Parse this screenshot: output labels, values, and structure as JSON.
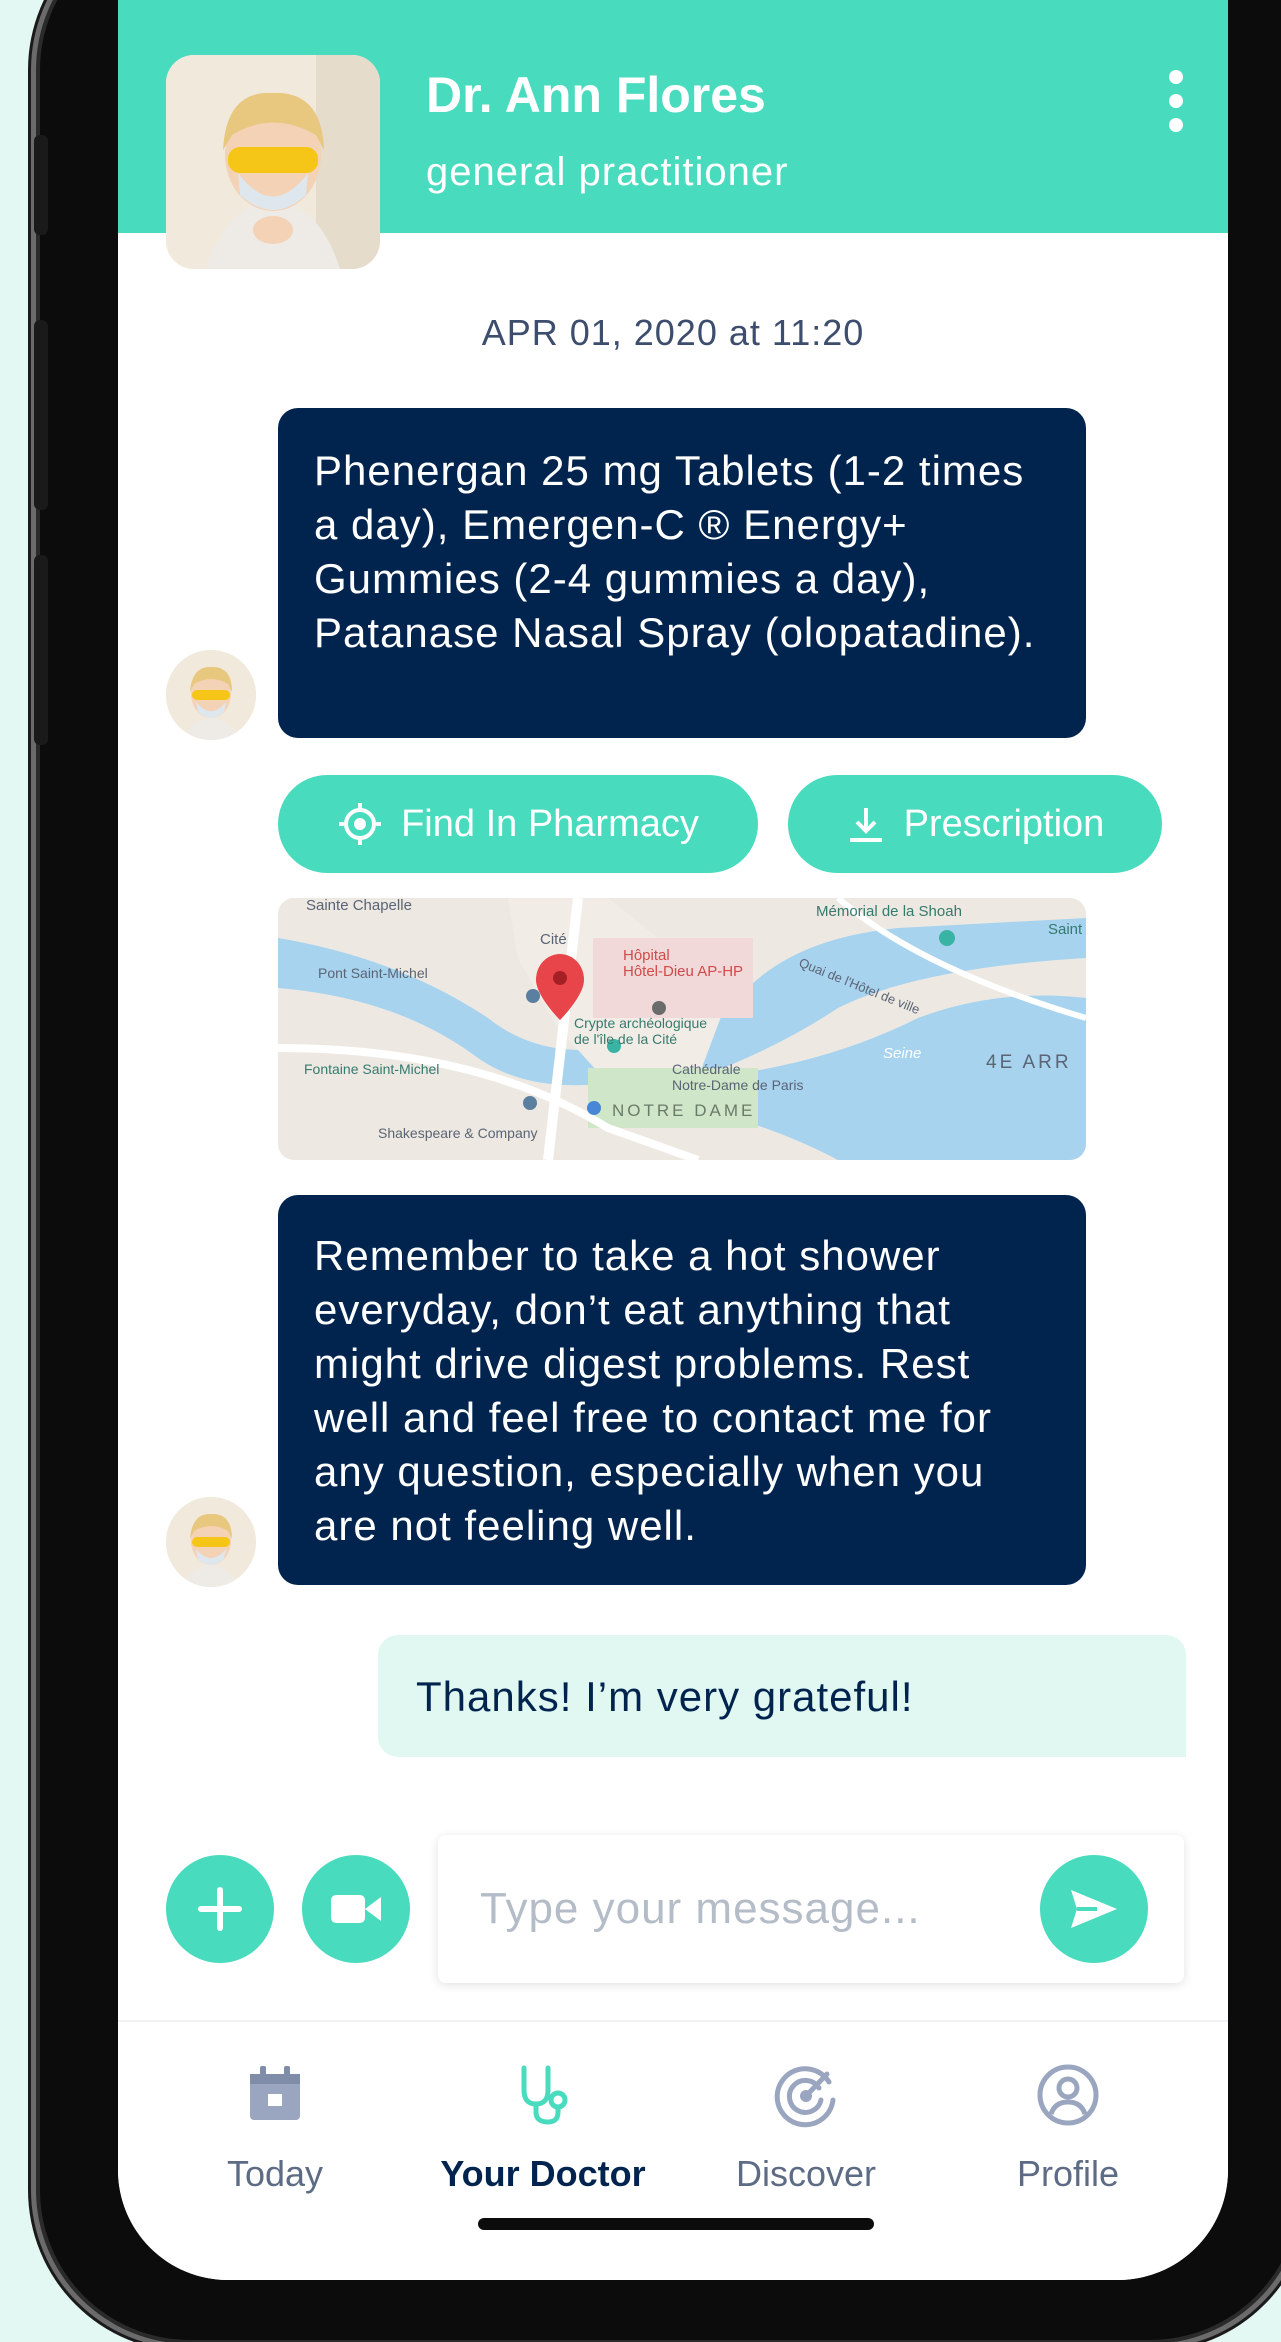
{
  "header": {
    "doctor_name": "Dr. Ann Flores",
    "doctor_title": "general practitioner",
    "menu_icon": "more-vertical-icon",
    "accent_color": "#49dbbd"
  },
  "chat": {
    "timestamp": "APR 01, 2020 at 11:20",
    "messages": [
      {
        "from": "doctor",
        "text": "Phenergan 25 mg Tablets (1-2 times a day), Emergen-C ® Energy+ Gummies (2-4 gummies a day), Patanase Nasal Spray (olopatadine)."
      },
      {
        "from": "doctor",
        "text": "Remember to take a hot shower everyday, don’t eat anything that might drive digest problems. Rest well and feel free to contact me for any question, especially when you are not feeling well."
      },
      {
        "from": "me",
        "text": "Thanks! I’m very grateful!"
      }
    ],
    "actions": {
      "find_pharmacy": {
        "label": "Find In Pharmacy",
        "icon": "location-target-icon"
      },
      "prescription": {
        "label": "Prescription",
        "icon": "download-icon"
      }
    },
    "map": {
      "labels": {
        "sainte_chapelle": "Sainte Chapelle",
        "cite": "Cité",
        "hopital": "Hôpital",
        "hotel_dieu": "Hôtel-Dieu AP-HP",
        "memorial": "Mémorial de la Shoah",
        "saint": "Saint",
        "pont_saint_michel": "Pont Saint-Michel",
        "crypte_1": "Crypte archéologique",
        "crypte_2": "de l'île de la Cité",
        "fontaine": "Fontaine Saint-Michel",
        "cathedrale": "Cathédrale",
        "notre_dame_paris": "Notre-Dame de Paris",
        "notre_dame": "NOTRE DAME",
        "seine": "Seine",
        "arr": "4E ARR",
        "quai_hotel": "Quai de l'Hôtel de ville",
        "shakespeare": "Shakespeare & Company"
      }
    }
  },
  "composer": {
    "placeholder": "Type your message...",
    "add_icon": "plus-icon",
    "video_icon": "video-camera-icon",
    "send_icon": "send-icon"
  },
  "nav": {
    "items": [
      {
        "label": "Today",
        "icon": "calendar-icon",
        "active": false
      },
      {
        "label": "Your Doctor",
        "icon": "stethoscope-icon",
        "active": true
      },
      {
        "label": "Discover",
        "icon": "discover-target-icon",
        "active": false
      },
      {
        "label": "Profile",
        "icon": "user-circle-icon",
        "active": false
      }
    ]
  },
  "colors": {
    "accent": "#49dbbd",
    "bubble_dark": "#01244f",
    "bubble_light": "#e1f8f2",
    "background": "#e4f8f3"
  }
}
